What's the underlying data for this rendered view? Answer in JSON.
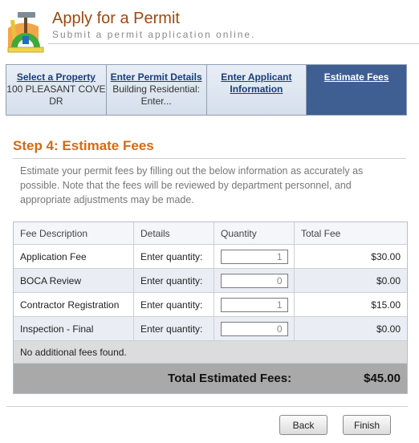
{
  "header": {
    "title": "Apply for a Permit",
    "subtitle": "Submit a permit application online.",
    "logo_icon": "tools-permit-icon",
    "title_color": "#9a4a12"
  },
  "wizard": {
    "steps": [
      {
        "label": "Select a Property",
        "detail": "100 PLEASANT COVE DR",
        "active": false
      },
      {
        "label": "Enter Permit Details",
        "detail": "Building Residential: Enter...",
        "active": false
      },
      {
        "label": "Enter Applicant Information",
        "detail": "",
        "active": false
      },
      {
        "label": "Estimate Fees",
        "detail": "",
        "active": true
      }
    ],
    "active_color": "#3f5f93"
  },
  "step": {
    "heading": "Step 4: Estimate Fees",
    "heading_color": "#d46a14",
    "instructions": "Estimate your permit fees by filling out the below information as accurately as possible. Note that the fees will be reviewed by department personnel, and appropriate adjustments may be made."
  },
  "fees_table": {
    "columns": [
      "Fee Description",
      "Details",
      "Quantity",
      "Total Fee"
    ],
    "rows": [
      {
        "description": "Application Fee",
        "details": "Enter quantity:",
        "quantity": "1",
        "total": "$30.00"
      },
      {
        "description": "BOCA Review",
        "details": "Enter quantity:",
        "quantity": "0",
        "total": "$0.00"
      },
      {
        "description": "Contractor Registration",
        "details": "Enter quantity:",
        "quantity": "1",
        "total": "$15.00"
      },
      {
        "description": "Inspection - Final",
        "details": "Enter quantity:",
        "quantity": "0",
        "total": "$0.00"
      }
    ],
    "no_additional": "No additional fees found.",
    "total_label": "Total Estimated Fees:",
    "total_value": "$45.00"
  },
  "buttons": {
    "back": "Back",
    "finish": "Finish"
  }
}
